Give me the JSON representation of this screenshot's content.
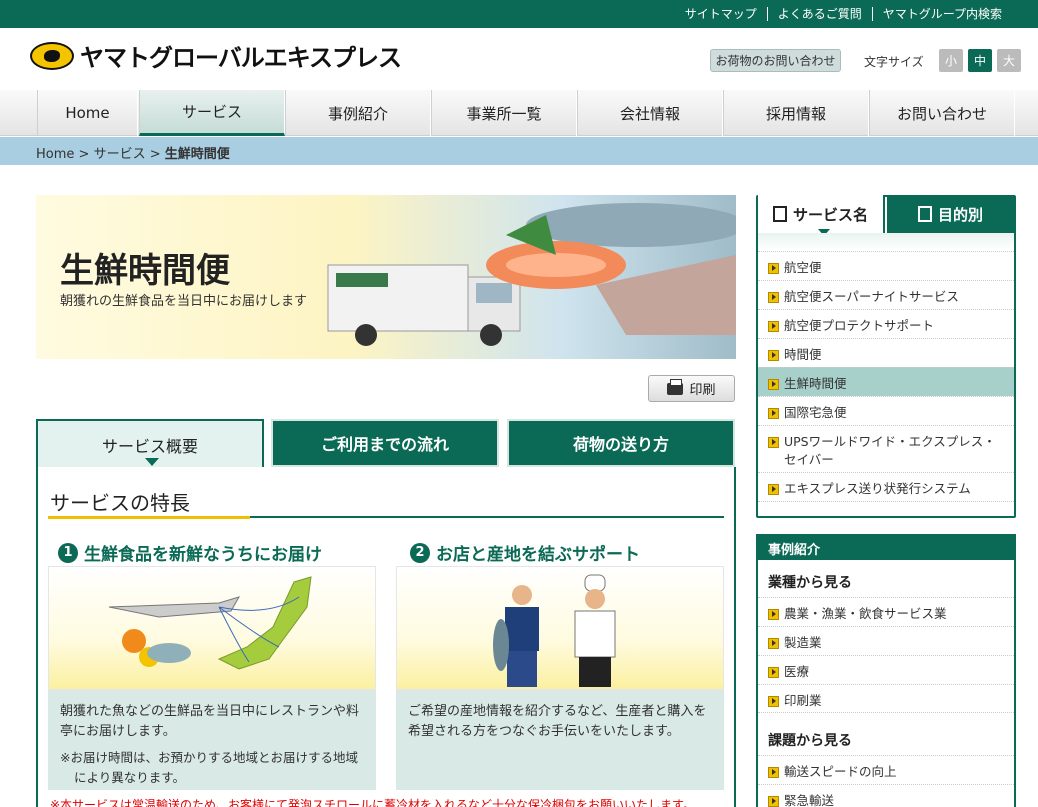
{
  "top_links": [
    "サイトマップ",
    "よくあるご質問",
    "ヤマトグループ内検索"
  ],
  "header": {
    "logo_text": "ヤマトグローバルエキスプレス",
    "inquiry_label": "お荷物のお問い合わせ",
    "font_size_label": "文字サイズ",
    "font_sizes": [
      "小",
      "中",
      "大"
    ]
  },
  "nav": [
    "Home",
    "サービス",
    "事例紹介",
    "事業所一覧",
    "会社情報",
    "採用情報",
    "お問い合わせ"
  ],
  "breadcrumb": {
    "home": "Home",
    "sep": ">",
    "service": "サービス",
    "current": "生鮮時間便"
  },
  "hero": {
    "title": "生鮮時間便",
    "subtitle": "朝獲れの生鮮食品を当日中にお届けします"
  },
  "print_label": "印刷",
  "tabs": [
    "サービス概要",
    "ご利用までの流れ",
    "荷物の送り方"
  ],
  "section_title": "サービスの特長",
  "features": [
    {
      "num": "1",
      "title": "生鮮食品を新鮮なうちにお届け",
      "desc": "朝獲れた魚などの生鮮品を当日中にレストランや料亭にお届けします。",
      "note": "※お届け時間は、お預かりする地域とお届けする地域により異なります。"
    },
    {
      "num": "2",
      "title": "お店と産地を結ぶサポート",
      "desc": "ご希望の産地情報を紹介するなど、生産者と購入を希望される方をつなぐお手伝いをいたします。"
    }
  ],
  "bottom_note": "※本サービスは常温輸送のため、お客様にて発泡スチロールに蓄冷材を入れるなど十分な保冷梱包をお願いいたします。",
  "side": {
    "tab_service": "サービス名",
    "tab_purpose": "目的別",
    "items": [
      "航空便",
      "航空便スーパーナイトサービス",
      "航空便プロテクトサポート",
      "時間便",
      "生鮮時間便",
      "国際宅急便",
      "UPSワールドワイド・エクスプレス・セイバー",
      "エキスプレス送り状発行システム"
    ],
    "case_title": "事例紹介",
    "by_industry": "業種から見る",
    "industries": [
      "農業・漁業・飲食サービス業",
      "製造業",
      "医療",
      "印刷業"
    ],
    "by_issue": "課題から見る",
    "issues": [
      "輸送スピードの向上",
      "緊急輸送"
    ]
  },
  "colors": {
    "brand": "#0a6a55",
    "accent": "#f1c000",
    "crumb_bg": "#a9cde1"
  }
}
